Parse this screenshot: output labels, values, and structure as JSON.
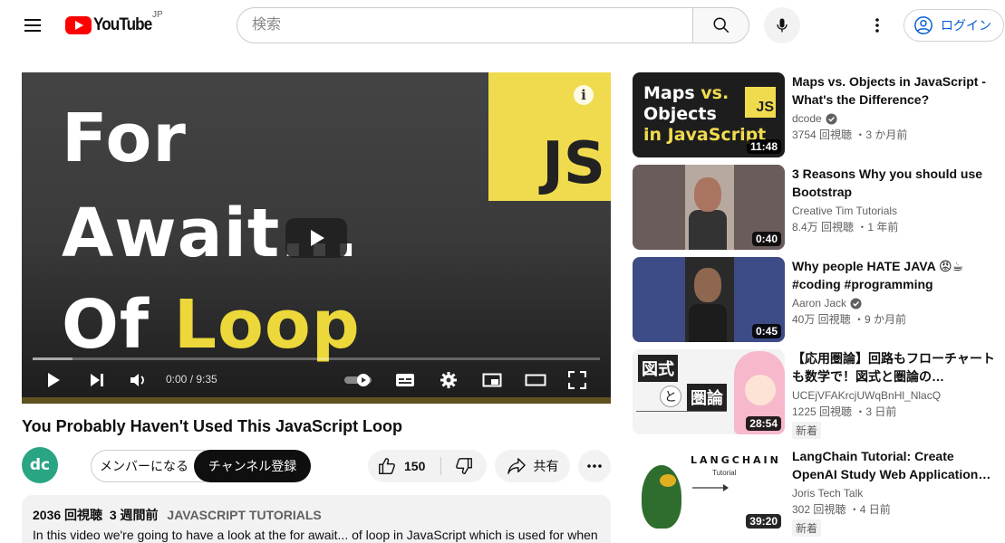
{
  "header": {
    "logo_text": "YouTube",
    "region": "JP",
    "search_placeholder": "検索",
    "login_label": "ログイン"
  },
  "player": {
    "thumb_line1": "For",
    "thumb_line2": "Await...",
    "thumb_line3_a": "Of ",
    "thumb_line3_b": "Loop",
    "js_badge": "JS",
    "time": "0:00 / 9:35",
    "progress_fraction": 0.07
  },
  "video": {
    "title": "You Probably Haven't Used This JavaScript Loop",
    "channel_avatar_text": "dc",
    "member_label": "メンバーになる",
    "subscribe_label": "チャンネル登録",
    "like_count": "150",
    "share_label": "共有",
    "views": "2036 回視聴",
    "age": "3 週間前",
    "tag": "JAVASCRIPT TUTORIALS",
    "description": "In this video we're going to have a look at the for await... of loop in JavaScript which is used for when"
  },
  "recommendations": [
    {
      "title": "Maps vs. Objects in JavaScript - What's the Difference?",
      "channel": "dcode",
      "verified": true,
      "meta": "3754 回視聴 ・3 か月前",
      "duration": "11:48",
      "badge": "",
      "thumb_text_1": "Maps ",
      "thumb_text_1b": "vs.",
      "thumb_text_2": "Objects",
      "thumb_text_3": "in JavaScript",
      "thumb_js": "JS"
    },
    {
      "title": "3 Reasons Why you should use Bootstrap",
      "channel": "Creative Tim Tutorials",
      "verified": false,
      "meta": "8.4万 回視聴 ・1 年前",
      "duration": "0:40",
      "badge": ""
    },
    {
      "title": "Why people HATE JAVA 😡☕ #coding #programming",
      "channel": "Aaron Jack",
      "verified": true,
      "meta": "40万 回視聴 ・9 か月前",
      "duration": "0:45",
      "badge": ""
    },
    {
      "title": "【応用圏論】回路もフローチャートも数学で！図式と圏論の…",
      "channel": "UCEjVFAKrcjUWqBnHl_NlacQ",
      "verified": false,
      "meta": "1225 回視聴 ・3 日前",
      "duration": "28:54",
      "badge": "新着",
      "thumb_k1": "図式",
      "thumb_to": "と",
      "thumb_k2": "圏論"
    },
    {
      "title": "LangChain Tutorial: Create OpenAI Study Web Application…",
      "channel": "Joris Tech Talk",
      "verified": false,
      "meta": "302 回視聴 ・4 日前",
      "duration": "39:20",
      "badge": "新着",
      "thumb_lc": "LANGCHAIN",
      "thumb_tut": "Tutorial"
    }
  ],
  "colors": {
    "brand_red": "#ff0000",
    "link_blue": "#065fd4",
    "js_yellow": "#f0db4f",
    "channel_green": "#2aa584"
  }
}
